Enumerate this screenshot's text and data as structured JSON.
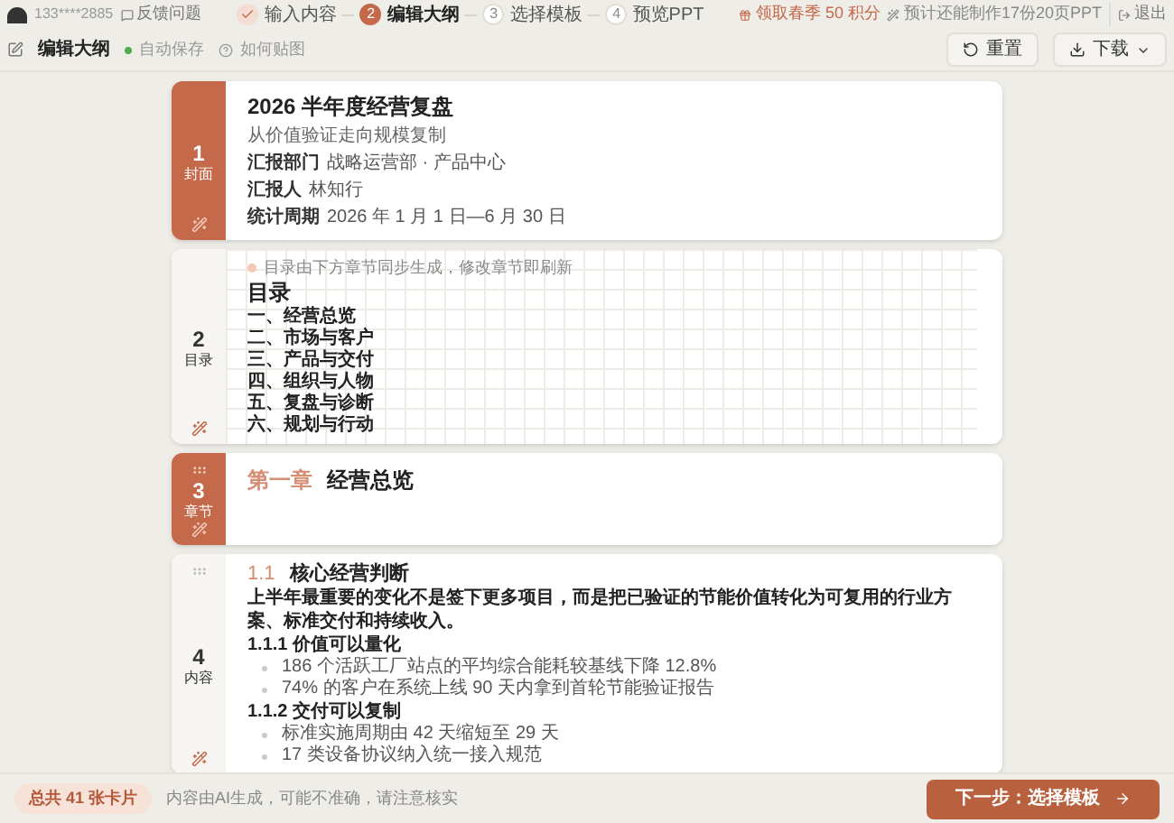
{
  "header": {
    "phone": "133****2885",
    "feedback": "反馈问题",
    "steps": [
      {
        "label": "输入内容",
        "done": true,
        "selected": false
      },
      {
        "number": "2",
        "label": "编辑大纲",
        "done": false,
        "selected": true
      },
      {
        "number": "3",
        "label": "选择模板",
        "done": false,
        "selected": false
      },
      {
        "number": "4",
        "label": "预览PPT",
        "done": false,
        "selected": false
      }
    ],
    "promo": "领取春季 50 积分",
    "quota": "预计还能制作17份20页PPT",
    "logout": "退出"
  },
  "toolbar": {
    "title": "编辑大纲",
    "autosave": "自动保存",
    "help": "如何贴图",
    "reset": "重置",
    "download": "下载"
  },
  "cards": [
    {
      "kind": "cover",
      "number": "1",
      "type": "封面",
      "draggable": false,
      "title": "2026 半年度经营复盘",
      "subtitle": "从价值验证走向规模复制",
      "fields": [
        {
          "label": "汇报部门",
          "value": "战略运营部 · 产品中心"
        },
        {
          "label": "汇报人",
          "value": "林知行"
        },
        {
          "label": "统计周期",
          "value": "2026 年 1 月 1 日—6 月 30 日"
        }
      ]
    },
    {
      "kind": "toc",
      "number": "2",
      "type": "目录",
      "draggable": false,
      "note": "目录由下方章节同步生成，修改章节即刷新",
      "title": "目录",
      "items": [
        "一、经营总览",
        "二、市场与客户",
        "三、产品与交付",
        "四、组织与人物",
        "五、复盘与诊断",
        "六、规划与行动"
      ]
    },
    {
      "kind": "chapter",
      "number": "3",
      "type": "章节",
      "draggable": true,
      "label": "第一章",
      "title": "经营总览"
    },
    {
      "kind": "content",
      "number": "4",
      "type": "内容",
      "draggable": true,
      "index": "1.1",
      "title": "核心经营判断",
      "lead": "上半年最重要的变化不是签下更多项目，而是把已验证的节能价值转化为可复用的行业方案、标准交付和持续收入。",
      "sections": [
        {
          "heading": "1.1.1 价值可以量化",
          "bullets": [
            "186 个活跃工厂站点的平均综合能耗较基线下降 12.8%",
            "74% 的客户在系统上线 90 天内拿到首轮节能验证报告"
          ]
        },
        {
          "heading": "1.1.2 交付可以复制",
          "bullets": [
            "标准实施周期由 42 天缩短至 29 天",
            "17 类设备协议纳入统一接入规范"
          ]
        }
      ]
    }
  ],
  "footer": {
    "count": "总共 41 张卡片",
    "disclaimer": "内容由AI生成，可能不准确，请注意核实",
    "next": "下一步：选择模板"
  }
}
